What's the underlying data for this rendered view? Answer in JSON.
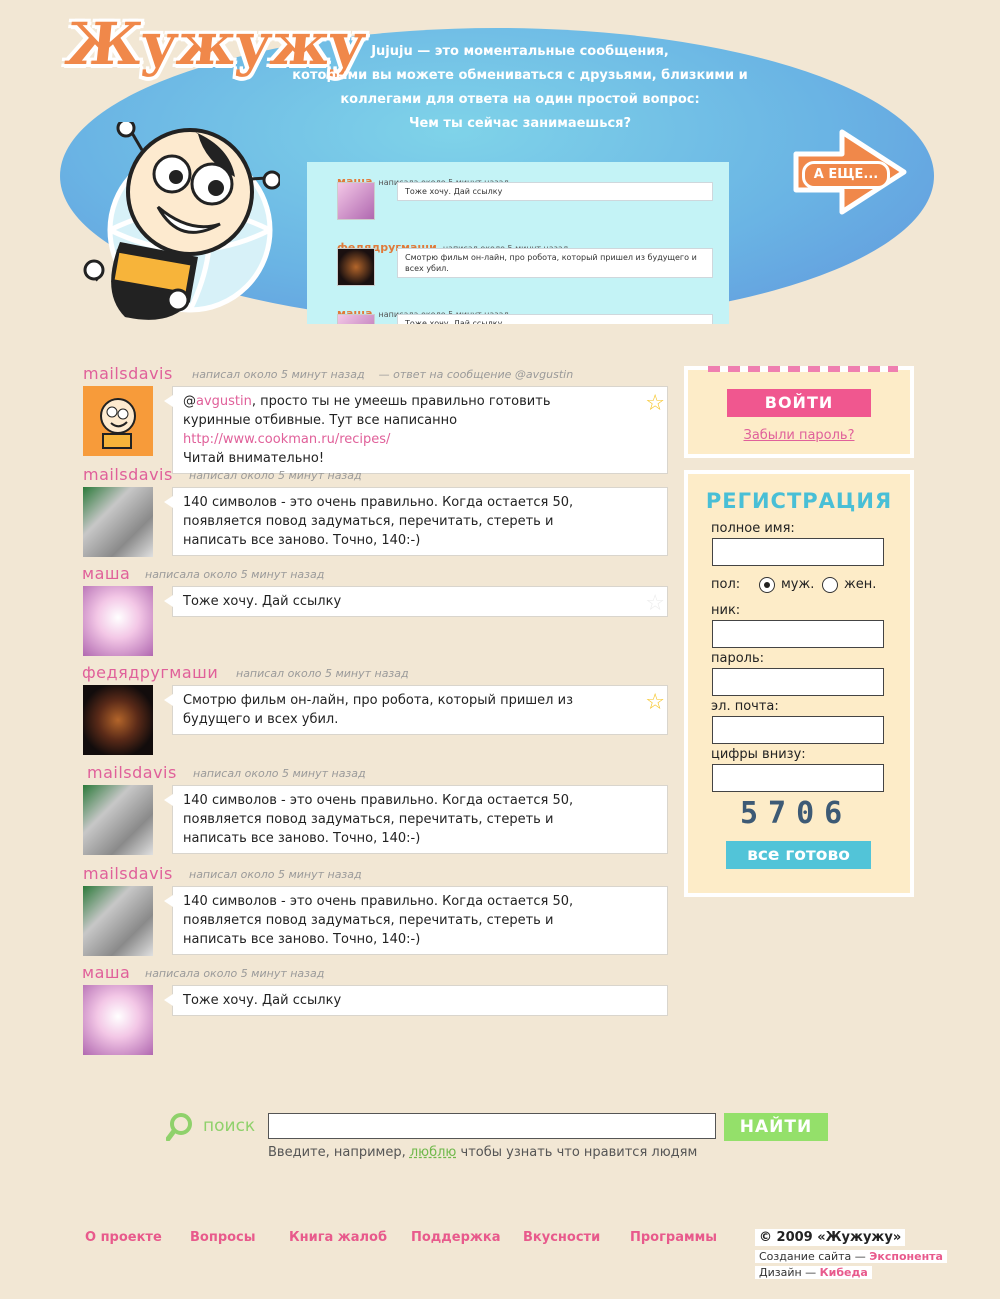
{
  "header": {
    "logo": "Жужужу",
    "intro_lines": [
      "Jujuju — это моментальные сообщения,",
      "которыми вы можете обмениваться с друзьями, близкими и",
      "коллегами для ответа на один простой вопрос:",
      "Чем ты сейчас занимаешься?"
    ],
    "more_label": "А ЕЩЕ...",
    "preview": [
      {
        "author": "маша",
        "time": "написала около 5 минут назад",
        "text": "Тоже хочу. Дай ссылку"
      },
      {
        "author": "федядругмаши",
        "time": "написал около 5 минут назад",
        "text": "Смотрю фильм он-лайн, про робота, который пришел из будущего и всех убил."
      },
      {
        "author": "маша",
        "time": "написала около 5 минут назад",
        "text": "Тоже хочу. Дай ссылку"
      }
    ]
  },
  "posts": [
    {
      "author": "mailsdavis",
      "time": "написал около 5 минут назад",
      "reply": "— ответ на сообщение @avgustin",
      "mention": "avgustin",
      "text_a": ", просто ты не умеешь правильно готовить куринные отбивные. Тут все написанно ",
      "link": "http://www.cookman.ru/recipes/",
      "text_b": "Читай внимательно!"
    },
    {
      "author": "mailsdavis",
      "time": "написал около 5 минут назад",
      "text": "140 символов - это очень правильно. Когда остается 50, появляется повод задуматься, перечитать, стереть и написать все заново. Точно, 140:-)"
    },
    {
      "author": "маша",
      "time": "написала около 5 минут назад",
      "text": "Тоже хочу. Дай ссылку"
    },
    {
      "author": "федядругмаши",
      "time": "написал около 5 минут назад",
      "text": "Смотрю фильм он-лайн, про робота, который пришел из будущего и всех убил."
    },
    {
      "author": "mailsdavis",
      "time": "написал около 5 минут назад",
      "text": "140 символов - это очень правильно. Когда остается 50, появляется повод задуматься, перечитать, стереть и написать все заново. Точно, 140:-)"
    },
    {
      "author": "mailsdavis",
      "time": "написал около 5 минут назад",
      "text": "140 символов - это очень правильно. Когда остается 50, появляется повод задуматься, перечитать, стереть и написать все заново. Точно, 140:-)"
    },
    {
      "author": "маша",
      "time": "написала около 5 минут назад",
      "text": "Тоже хочу. Дай ссылку"
    }
  ],
  "login": {
    "button": "ВОЙТИ",
    "forgot": "Забыли пароль?"
  },
  "registration": {
    "title": "РЕГИСТРАЦИЯ",
    "full_name": "полное имя:",
    "gender": "пол:",
    "male": "муж.",
    "female": "жен.",
    "nick": "ник:",
    "password": "пароль:",
    "email": "эл. почта:",
    "captcha_label": "цифры внизу:",
    "captcha": "5706",
    "submit": "все готово"
  },
  "search": {
    "label": "поиск",
    "button": "НАЙТИ",
    "hint_a": "Введите, например, ",
    "hint_example": "люблю",
    "hint_b": " чтобы узнать что нравится людям"
  },
  "footer": {
    "links": [
      "О проекте",
      "Вопросы",
      "Книга жалоб",
      "Поддержка",
      "Вкусности",
      "Программы"
    ],
    "copyright": "© 2009 «Жужужу»",
    "credit1_text": "Создание сайта — ",
    "credit1_name": "Экспонента",
    "credit2_text": "Дизайн — ",
    "credit2_name": "Кибеда"
  },
  "colors": {
    "accent_pink": "#e0609a",
    "accent_orange": "#f0884a",
    "accent_cyan": "#52c4d8",
    "accent_green": "#94e06a",
    "background": "#f2e7d4"
  }
}
